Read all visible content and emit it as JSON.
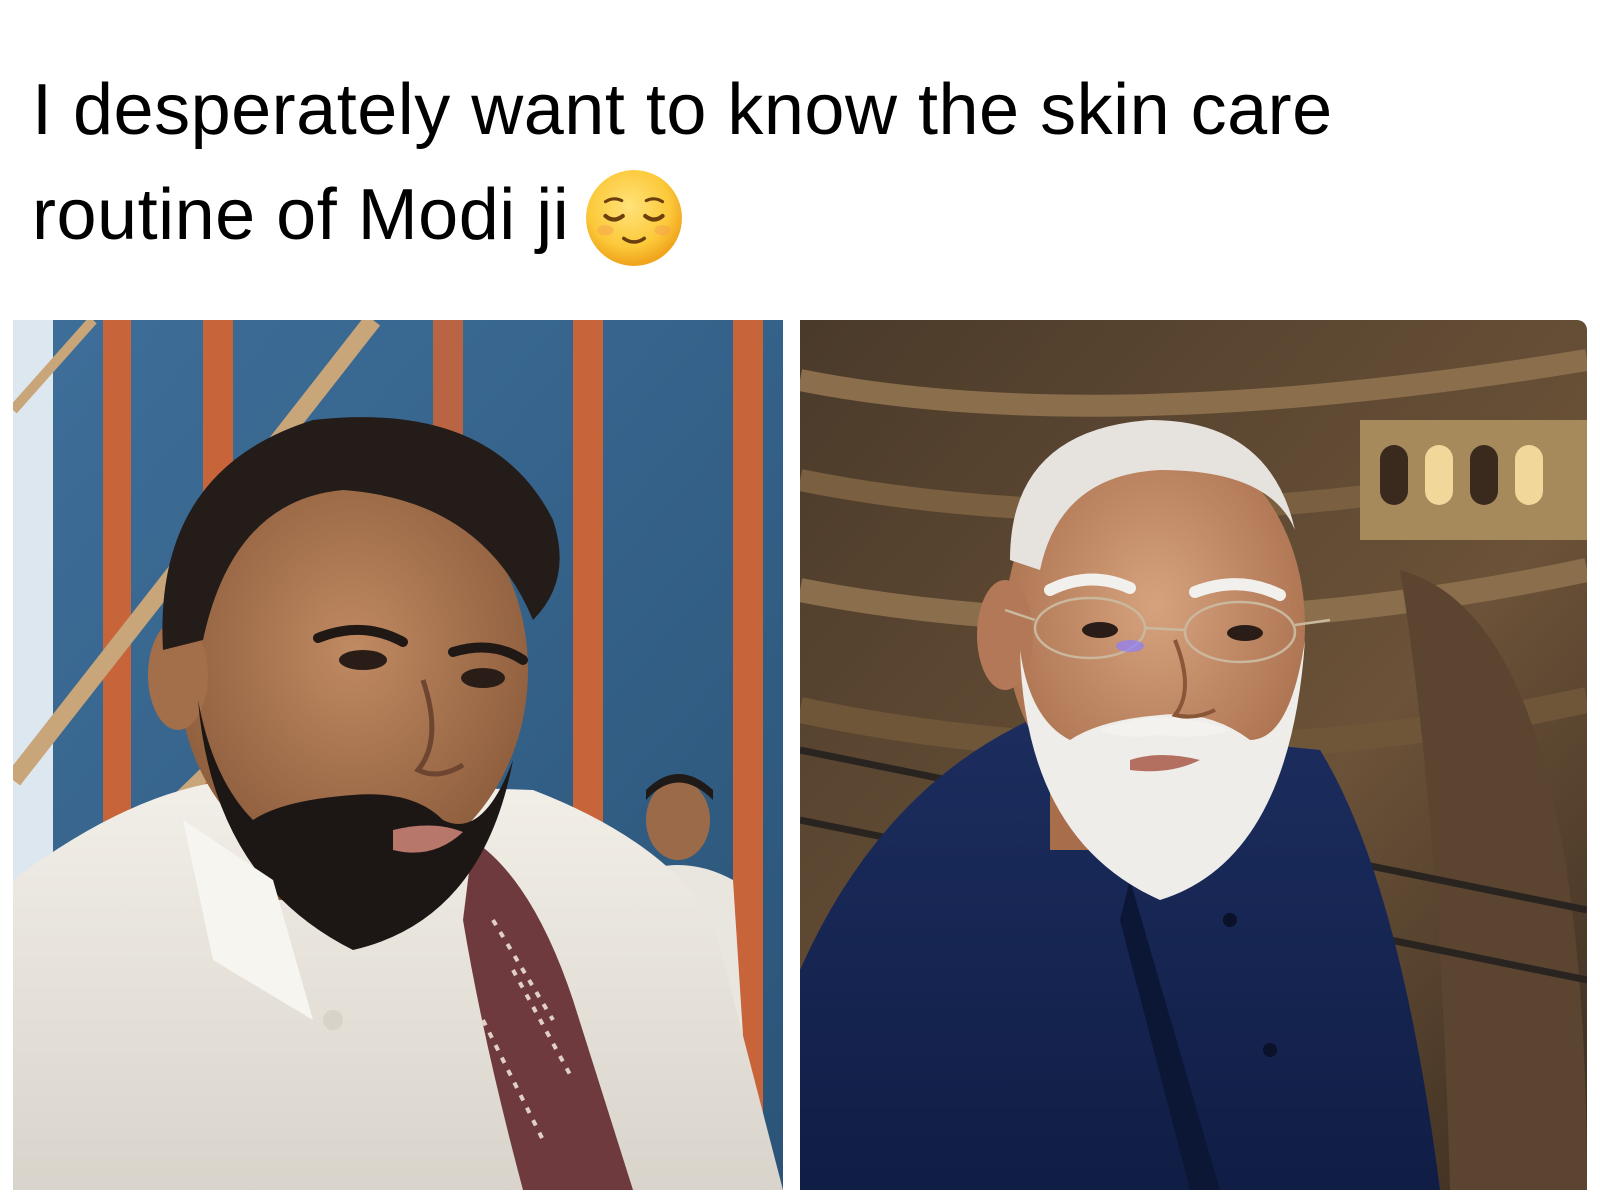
{
  "caption": {
    "line1": "I desperately want to know the skin care",
    "line2": "routine of Modi ji",
    "emoji": "relieved-face-icon"
  },
  "photos": [
    {
      "name": "photo-young-man",
      "icon": "photo-left"
    },
    {
      "name": "photo-older-man",
      "icon": "photo-right"
    }
  ],
  "colors": {
    "background": "#ffffff",
    "text": "#000000",
    "emoji_face": "#ffcc4d"
  }
}
